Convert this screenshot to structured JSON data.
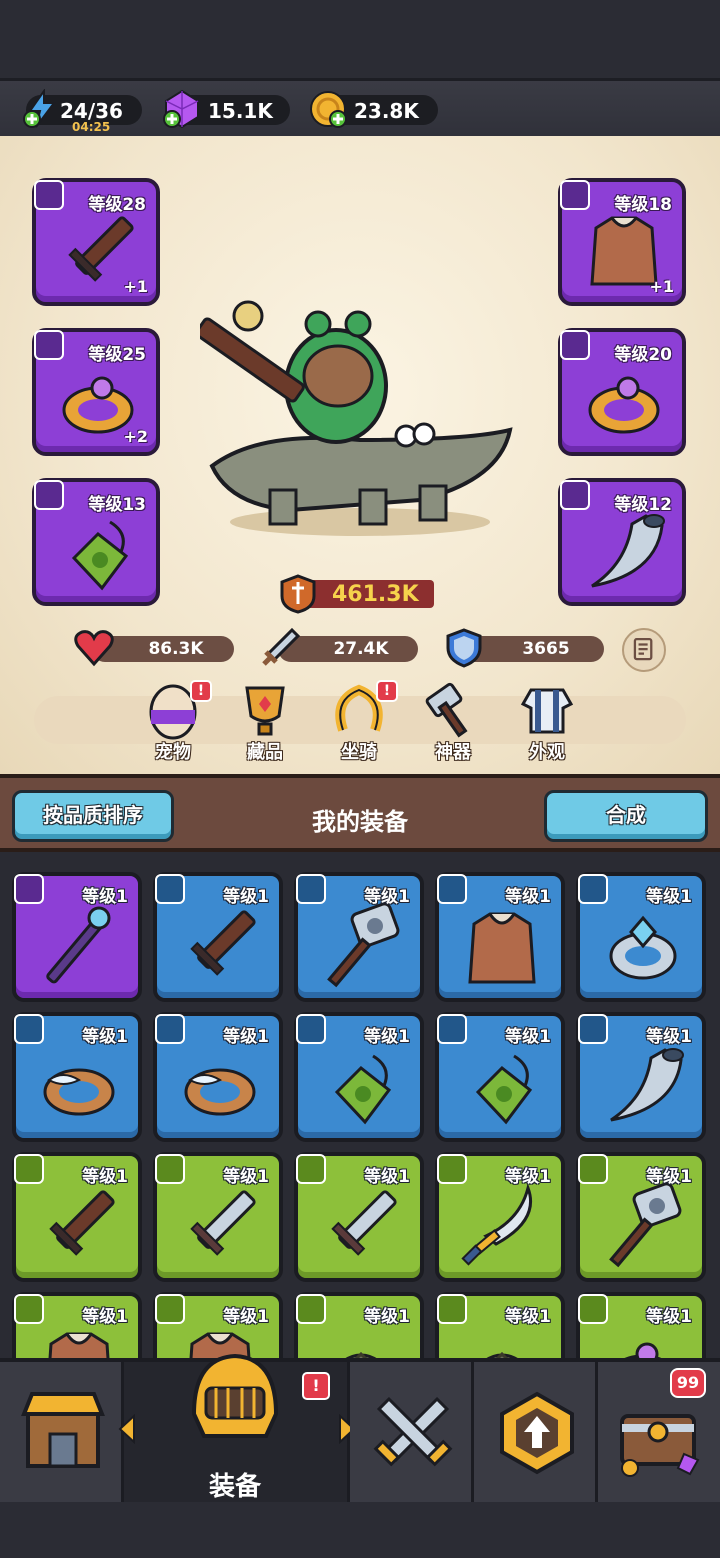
{
  "resources": {
    "energy": {
      "value": "24/36",
      "timer": "04:25",
      "icon": "lightning-plus-icon"
    },
    "gems": {
      "value": "15.1K",
      "icon": "purple-gem-plus-icon"
    },
    "coins": {
      "value": "23.8K",
      "icon": "gold-coin-plus-icon"
    }
  },
  "equipped": {
    "weapon": {
      "level": "等级28",
      "bonus": "+1",
      "item": "wooden-sword"
    },
    "armor": {
      "level": "等级18",
      "bonus": "+1",
      "item": "leather-vest"
    },
    "ring_left": {
      "level": "等级25",
      "bonus": "+2",
      "item": "gold-ring"
    },
    "ring_right": {
      "level": "等级20",
      "item": "gold-ring"
    },
    "necklace": {
      "level": "等级13",
      "item": "green-amulet"
    },
    "horn": {
      "level": "等级12",
      "item": "silver-horn"
    }
  },
  "power": "461.3K",
  "stats": {
    "hp": "86.3K",
    "attack": "27.4K",
    "defense": "3665"
  },
  "features": [
    {
      "label": "宠物",
      "alert": "!"
    },
    {
      "label": "藏品"
    },
    {
      "label": "坐骑",
      "alert": "!"
    },
    {
      "label": "神器"
    },
    {
      "label": "外观"
    }
  ],
  "equipment_header": {
    "sort_button": "按品质排序",
    "title": "我的装备",
    "merge_button": "合成"
  },
  "inventory": [
    {
      "level": "等级1",
      "rarity": "purple",
      "item": "staff"
    },
    {
      "level": "等级1",
      "rarity": "blue",
      "item": "wooden-sword"
    },
    {
      "level": "等级1",
      "rarity": "blue",
      "item": "hammer"
    },
    {
      "level": "等级1",
      "rarity": "blue",
      "item": "leather-vest"
    },
    {
      "level": "等级1",
      "rarity": "blue",
      "item": "crystal-ring"
    },
    {
      "level": "等级1",
      "rarity": "blue",
      "item": "feather-ring"
    },
    {
      "level": "等级1",
      "rarity": "blue",
      "item": "feather-ring"
    },
    {
      "level": "等级1",
      "rarity": "blue",
      "item": "green-amulet"
    },
    {
      "level": "等级1",
      "rarity": "blue",
      "item": "green-amulet"
    },
    {
      "level": "等级1",
      "rarity": "blue",
      "item": "silver-horn"
    },
    {
      "level": "等级1",
      "rarity": "green",
      "item": "wooden-sword"
    },
    {
      "level": "等级1",
      "rarity": "green",
      "item": "steel-sword"
    },
    {
      "level": "等级1",
      "rarity": "green",
      "item": "steel-sword"
    },
    {
      "level": "等级1",
      "rarity": "green",
      "item": "curved-sword"
    },
    {
      "level": "等级1",
      "rarity": "green",
      "item": "hammer"
    },
    {
      "level": "等级1",
      "rarity": "green",
      "item": "leather-vest"
    },
    {
      "level": "等级1",
      "rarity": "green",
      "item": "leather-vest"
    },
    {
      "level": "等级1",
      "rarity": "green",
      "item": "turtle-armor"
    },
    {
      "level": "等级1",
      "rarity": "green",
      "item": "turtle-armor"
    },
    {
      "level": "等级1",
      "rarity": "green",
      "item": "gold-ring"
    }
  ],
  "nav": {
    "active_label": "装备",
    "alert": "!",
    "chest_count": "99",
    "items": [
      "shop-icon",
      "helmet-icon",
      "crossed-swords-icon",
      "upgrade-arrow-icon",
      "treasure-chest-icon"
    ]
  },
  "colors": {
    "purple": "#8d3fd6",
    "blue": "#3c8ad0",
    "green": "#8dc03a",
    "accent": "#6fcae6",
    "power": "#f6d34c"
  }
}
